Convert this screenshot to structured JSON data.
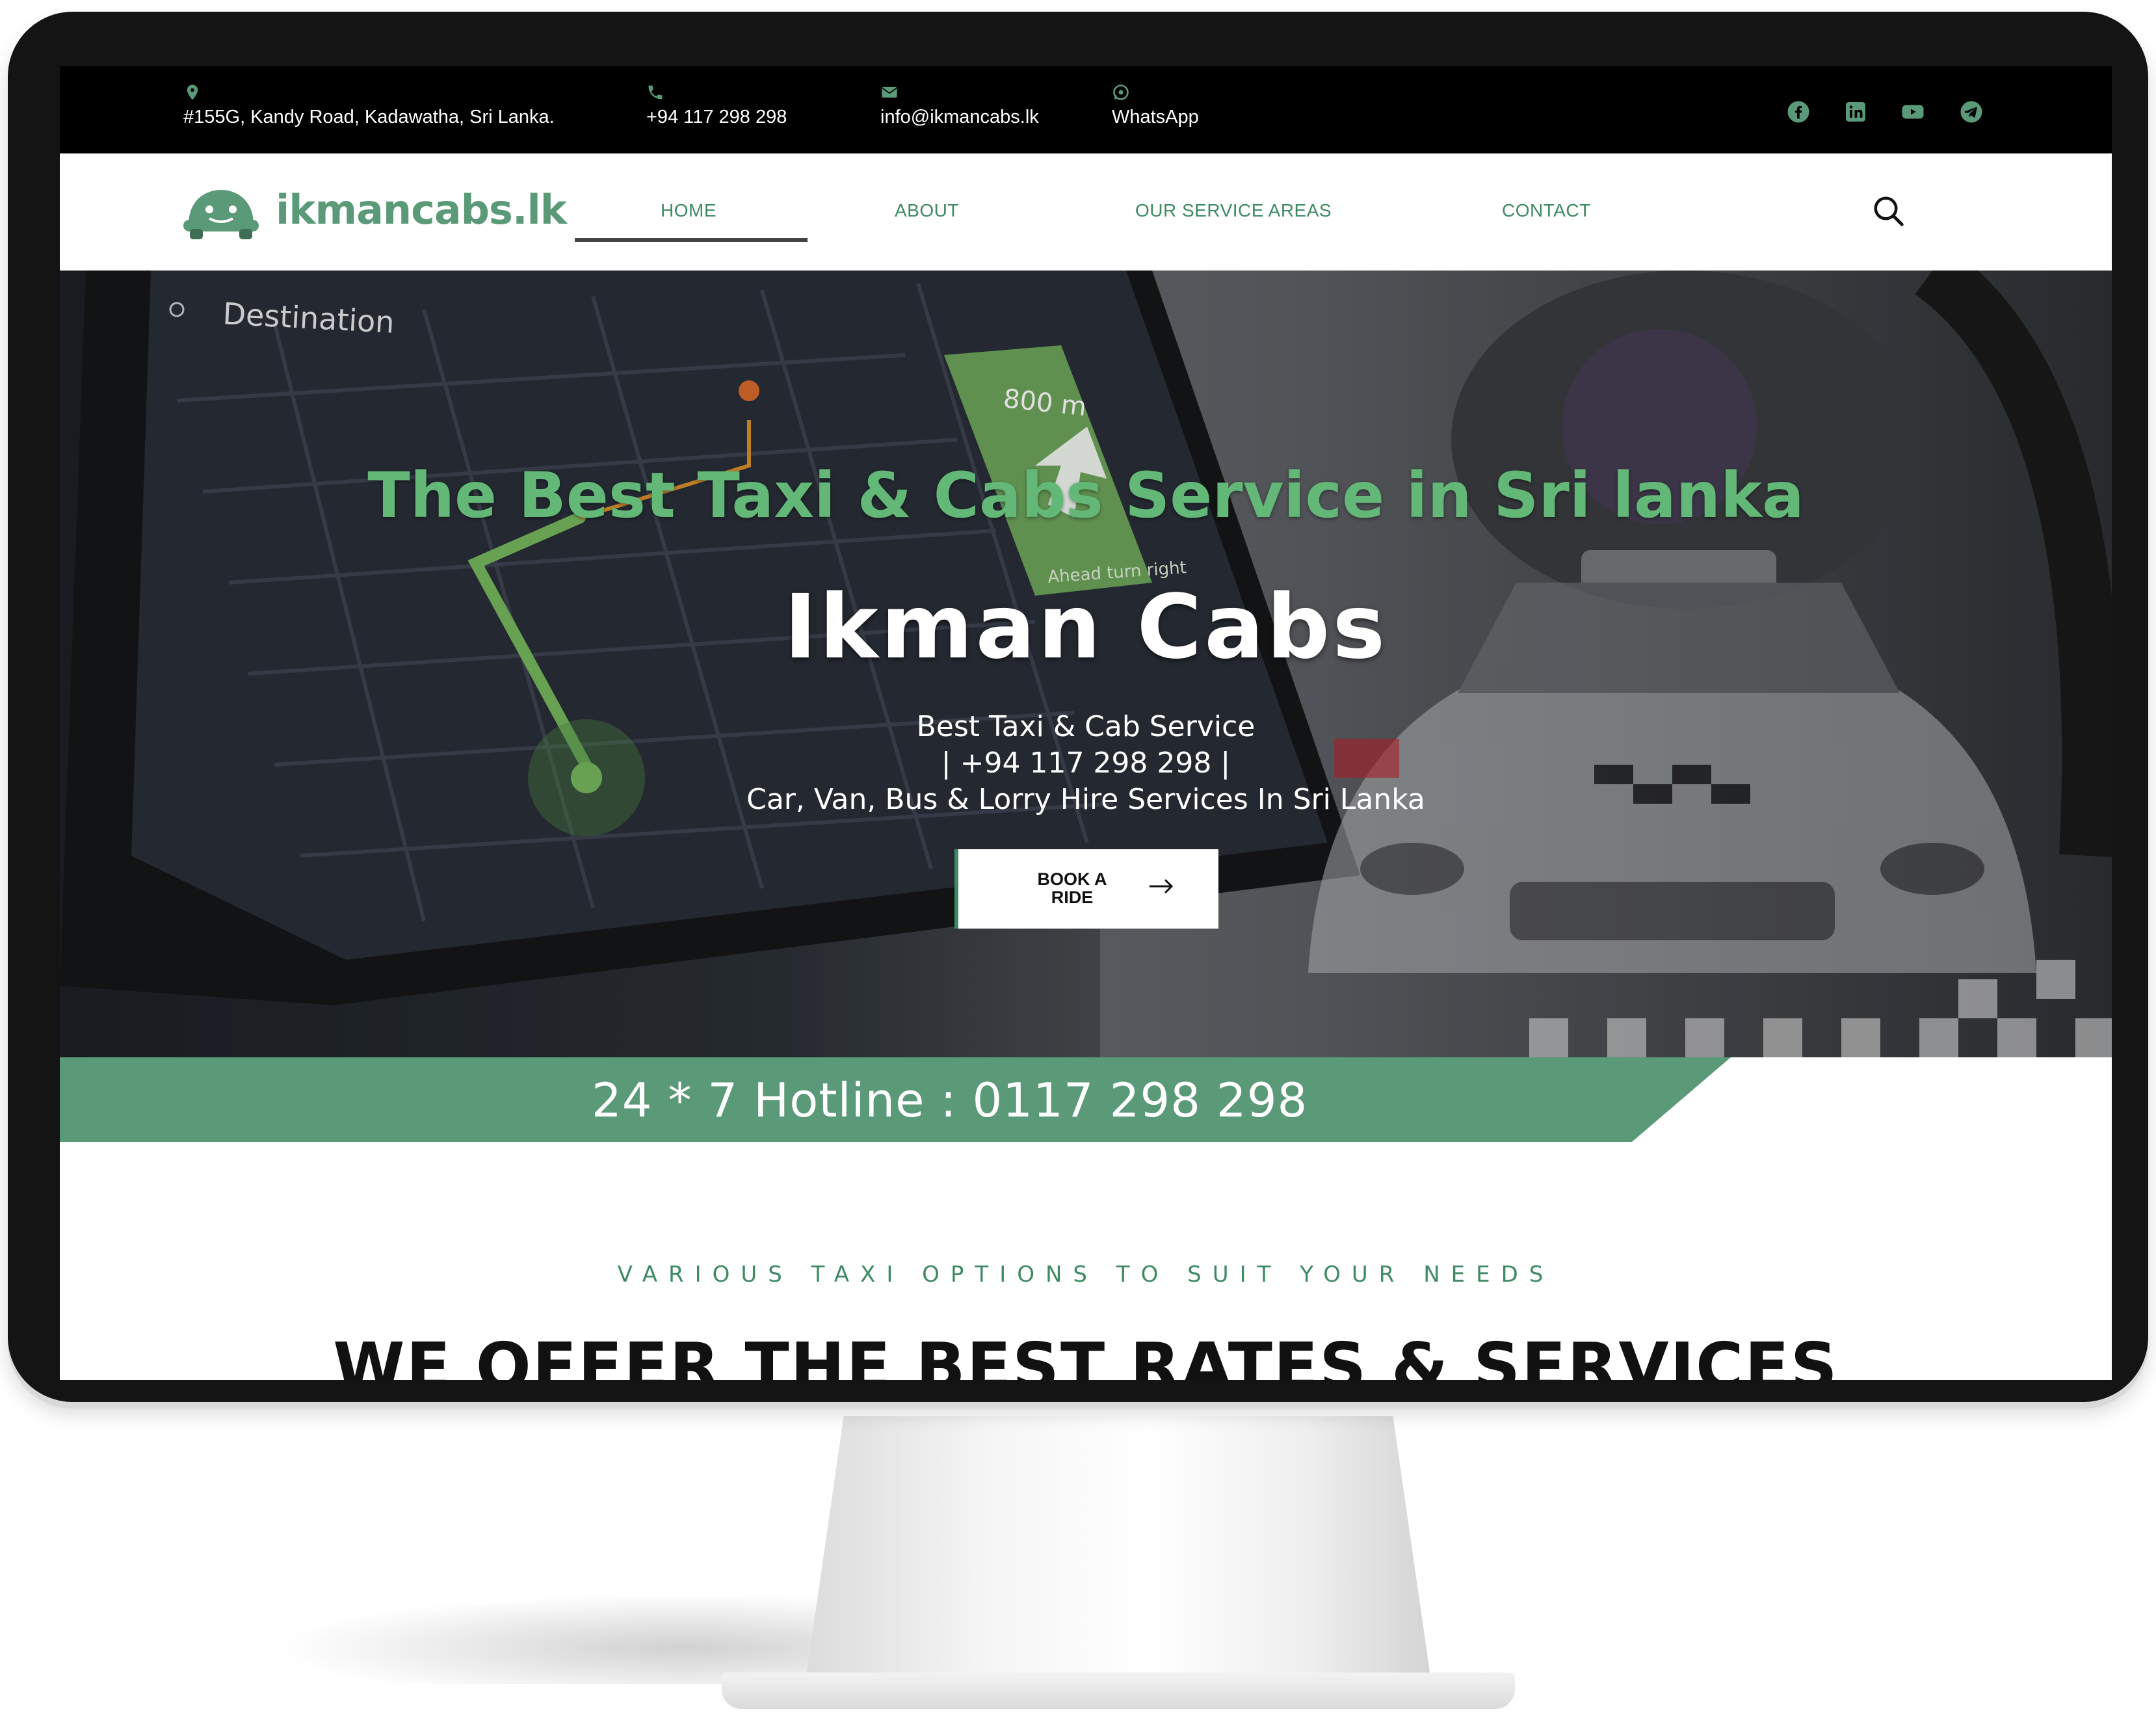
{
  "topbar": {
    "address": "#155G, Kandy Road, Kadawatha, Sri Lanka.",
    "phone": "+94 117 298 298",
    "email": "info@ikmancabs.lk",
    "whatsapp": "WhatsApp",
    "social": [
      "facebook-icon",
      "linkedin-icon",
      "youtube-icon",
      "telegram-icon"
    ]
  },
  "header": {
    "logo_text": "ikmancabs.lk",
    "nav": [
      {
        "label": "HOME",
        "active": true
      },
      {
        "label": "ABOUT",
        "active": false
      },
      {
        "label": "OUR SERVICE AREAS",
        "active": false
      },
      {
        "label": "CONTACT",
        "active": false
      }
    ]
  },
  "hero": {
    "screen_destination": "Destination",
    "screen_distance": "800 m",
    "screen_instruction": "Ahead turn right",
    "tagline": "The Best Taxi & Cabs Service in Sri lanka",
    "title": "Ikman Cabs",
    "line1": "Best Taxi & Cab Service",
    "line2": "| +94 117 298 298 |",
    "line3": "Car, Van, Bus & Lorry Hire Services In Sri Lanka",
    "cta_line1": "BOOK A",
    "cta_line2": "RIDE"
  },
  "hotline": {
    "text": "24 * 7 Hotline : 0117 298 298"
  },
  "section": {
    "eyebrow": "VARIOUS TAXI OPTIONS TO SUIT YOUR NEEDS",
    "title": "WE OFFER THE BEST RATES & SERVICES"
  },
  "colors": {
    "brand_green": "#5a9a78",
    "accent_green": "#63b878",
    "topbar": "#000000"
  }
}
